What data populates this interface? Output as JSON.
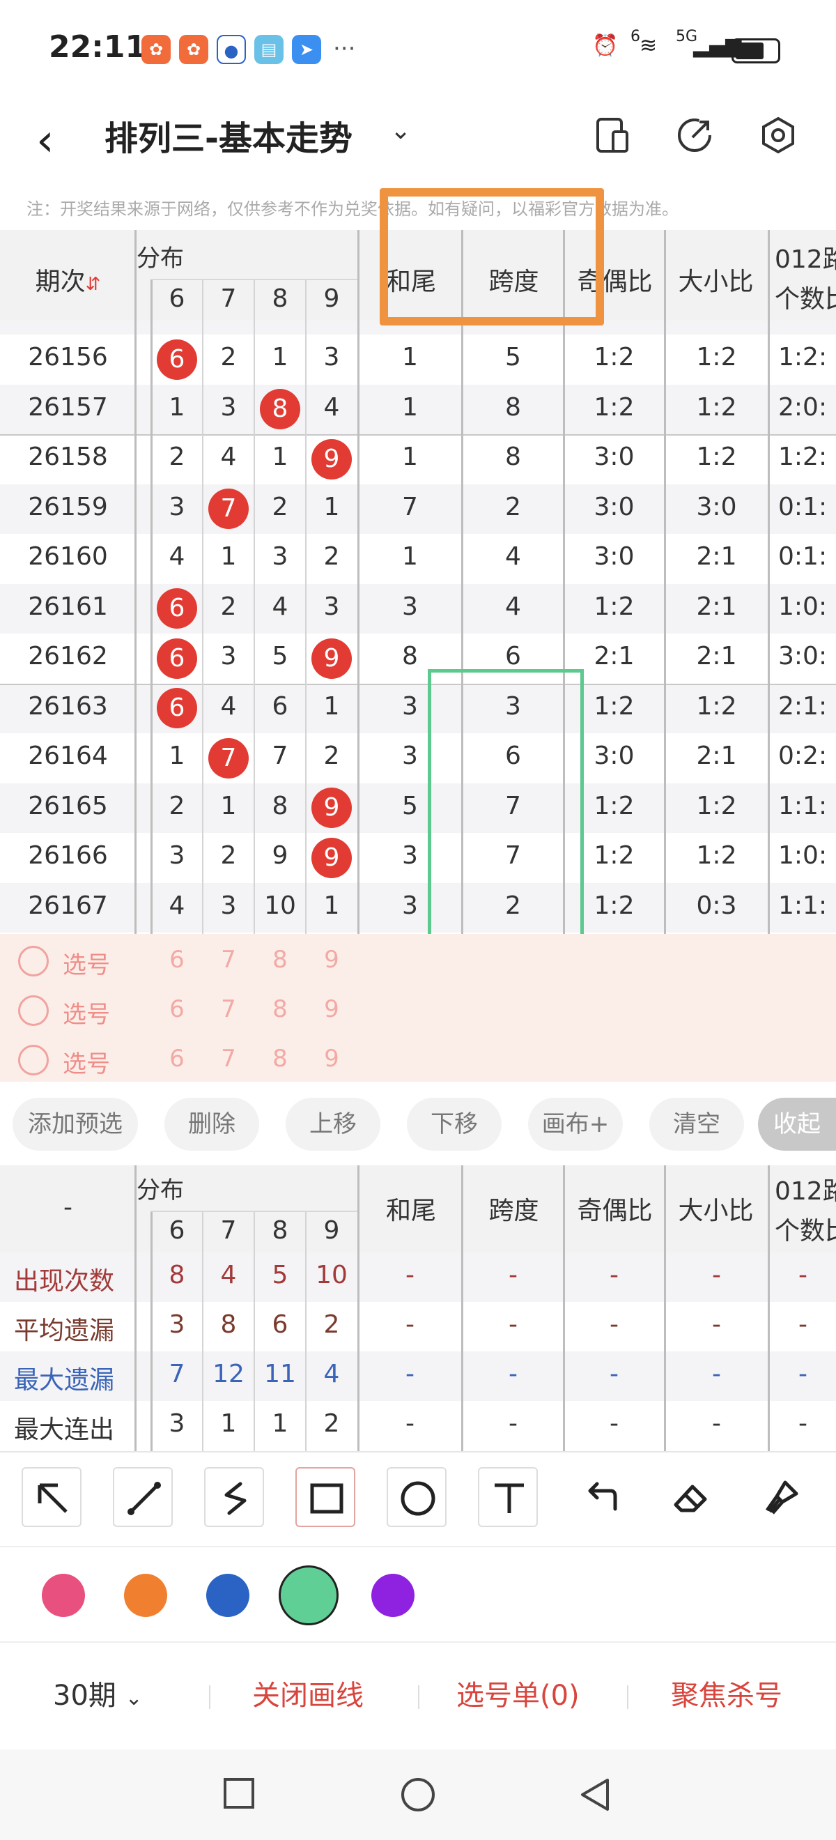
{
  "status": {
    "time": "22:11",
    "dots": "···",
    "network": "5G",
    "wifi_label": "6"
  },
  "titlebar": {
    "title": "排列三-基本走势"
  },
  "note": "注：开奖结果来源于网络，仅供参考不作为兑奖依据。如有疑问，以福彩官方数据为准。",
  "table": {
    "header": {
      "period": "期次",
      "dist": "分布",
      "digits": [
        "6",
        "7",
        "8",
        "9"
      ],
      "sum_tail": "和尾",
      "span": "跨度",
      "odd_even": "奇偶比",
      "big_small": "大小比",
      "road012_line1": "012路",
      "road012_line2": "个数比"
    },
    "rows": [
      {
        "period": "26156",
        "d6": "6",
        "d7": "2",
        "d8": "1",
        "d9": "3",
        "sum_tail": "1",
        "span": "5",
        "odd_even": "1:2",
        "big_small": "1:2",
        "road": "1:2:",
        "hot": [
          "d6"
        ]
      },
      {
        "period": "26157",
        "d6": "1",
        "d7": "3",
        "d8": "8",
        "d9": "4",
        "sum_tail": "1",
        "span": "8",
        "odd_even": "1:2",
        "big_small": "1:2",
        "road": "2:0:",
        "hot": [
          "d8"
        ]
      },
      {
        "period": "26158",
        "d6": "2",
        "d7": "4",
        "d8": "1",
        "d9": "9",
        "sum_tail": "1",
        "span": "8",
        "odd_even": "3:0",
        "big_small": "1:2",
        "road": "1:2:",
        "hot": [
          "d9"
        ]
      },
      {
        "period": "26159",
        "d6": "3",
        "d7": "7",
        "d8": "2",
        "d9": "1",
        "sum_tail": "7",
        "span": "2",
        "odd_even": "3:0",
        "big_small": "3:0",
        "road": "0:1:",
        "hot": [
          "d7"
        ]
      },
      {
        "period": "26160",
        "d6": "4",
        "d7": "1",
        "d8": "3",
        "d9": "2",
        "sum_tail": "1",
        "span": "4",
        "odd_even": "3:0",
        "big_small": "2:1",
        "road": "0:1:",
        "hot": []
      },
      {
        "period": "26161",
        "d6": "6",
        "d7": "2",
        "d8": "4",
        "d9": "3",
        "sum_tail": "3",
        "span": "4",
        "odd_even": "1:2",
        "big_small": "2:1",
        "road": "1:0:",
        "hot": [
          "d6"
        ]
      },
      {
        "period": "26162",
        "d6": "6",
        "d7": "3",
        "d8": "5",
        "d9": "9",
        "sum_tail": "8",
        "span": "6",
        "odd_even": "2:1",
        "big_small": "2:1",
        "road": "3:0:",
        "hot": [
          "d6",
          "d9"
        ]
      },
      {
        "period": "26163",
        "d6": "6",
        "d7": "4",
        "d8": "6",
        "d9": "1",
        "sum_tail": "3",
        "span": "3",
        "odd_even": "1:2",
        "big_small": "1:2",
        "road": "2:1:",
        "hot": [
          "d6"
        ]
      },
      {
        "period": "26164",
        "d6": "1",
        "d7": "7",
        "d8": "7",
        "d9": "2",
        "sum_tail": "3",
        "span": "6",
        "odd_even": "3:0",
        "big_small": "2:1",
        "road": "0:2:",
        "hot": [
          "d7"
        ]
      },
      {
        "period": "26165",
        "d6": "2",
        "d7": "1",
        "d8": "8",
        "d9": "9",
        "sum_tail": "5",
        "span": "7",
        "odd_even": "1:2",
        "big_small": "1:2",
        "road": "1:1:",
        "hot": [
          "d9"
        ]
      },
      {
        "period": "26166",
        "d6": "3",
        "d7": "2",
        "d8": "9",
        "d9": "9",
        "sum_tail": "3",
        "span": "7",
        "odd_even": "1:2",
        "big_small": "1:2",
        "road": "1:0:",
        "hot": [
          "d9"
        ]
      },
      {
        "period": "26167",
        "d6": "4",
        "d7": "3",
        "d8": "10",
        "d9": "1",
        "sum_tail": "3",
        "span": "2",
        "odd_even": "1:2",
        "big_small": "0:3",
        "road": "1:1:",
        "hot": []
      }
    ]
  },
  "picker": {
    "label": "选号",
    "digits": [
      "6",
      "7",
      "8",
      "9"
    ]
  },
  "actions": [
    "添加预选",
    "删除",
    "上移",
    "下移",
    "画布+",
    "清空",
    "收起"
  ],
  "stats": {
    "header_dash": "-",
    "rows": [
      {
        "label": "出现次数",
        "values": [
          "8",
          "4",
          "5",
          "10"
        ],
        "color": "#a33a3a"
      },
      {
        "label": "平均遗漏",
        "values": [
          "3",
          "8",
          "6",
          "2"
        ],
        "color": "#7a3b2e"
      },
      {
        "label": "最大遗漏",
        "values": [
          "7",
          "12",
          "11",
          "4"
        ],
        "color": "#3a64b8"
      },
      {
        "label": "最大连出",
        "values": [
          "3",
          "1",
          "1",
          "2"
        ],
        "color": "#333333"
      }
    ],
    "dash": "-"
  },
  "draw_tools": [
    "arrow-tool",
    "line-tool",
    "freehand-tool",
    "rectangle-tool",
    "circle-tool",
    "text-tool",
    "undo-tool",
    "eraser-tool",
    "clear-brush-tool"
  ],
  "colors": {
    "swatches": [
      "#e8507f",
      "#f08030",
      "#2a63c4",
      "#5fcf95",
      "#8e22e0"
    ],
    "selected": "#5fcf95",
    "orange_box": "#ef9340",
    "green_box": "#5cc98e",
    "ball_red": "#e23b33"
  },
  "bottom": {
    "period_select": "30期",
    "close_draw": "关闭画线",
    "pick_list": "选号单(0)",
    "focus_kill": "聚焦杀号"
  }
}
